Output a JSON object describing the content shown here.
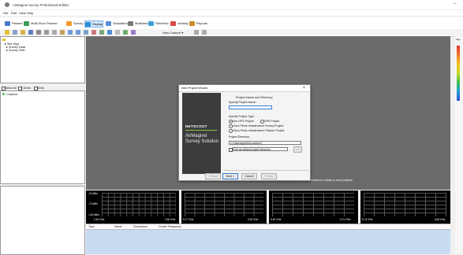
{
  "app": {
    "title": "AirMagnet Survey Professional Edition",
    "minimize": "—"
  },
  "menu": [
    "File",
    "Edit",
    "View",
    "Help"
  ],
  "ribbon": {
    "items": [
      {
        "label": "Planner",
        "color": "#4a7bd0"
      },
      {
        "label": "Multi-Floor Planner",
        "color": "#3b9c58"
      },
      {
        "label": "Survey",
        "color": "#f09a2a"
      },
      {
        "label": "Display",
        "color": "#2f8fd6"
      },
      {
        "label": "Simulation",
        "color": "#5b8fd8"
      },
      {
        "label": "Multiview",
        "color": "#7a7a7a"
      },
      {
        "label": "iSiteView",
        "color": "#3ea0d8"
      },
      {
        "label": "vorticity",
        "color": "#d84a4a"
      },
      {
        "label": "Reports",
        "color": "#cc8d2a"
      }
    ],
    "selected_index": 3
  },
  "toolbar2": {
    "view_channel_label": "View Channel ▾"
  },
  "site_tree": {
    "items": [
      "Site Map",
      "Survey Data",
      "Survey Path"
    ]
  },
  "band_filter": {
    "select_all": "Select All",
    "band_24": "2.4GHz",
    "band_5": "5GHz"
  },
  "channel_list": {
    "header": "Channel"
  },
  "dialog": {
    "title": "New Project Wizard",
    "close": "×",
    "section_heading": "Project Name and Directory",
    "name_label": "Specify Project Name:",
    "name_value": "",
    "type_label": "Specify Project Type:",
    "types": [
      {
        "label": "Non GPS Project",
        "on": true
      },
      {
        "label": "GPS Project",
        "on": false
      },
      {
        "label": "Cisco Prime Infrastructure Survey Project",
        "on": false
      },
      {
        "label": "Cisco Prime Infrastructure Planner Project",
        "on": false
      }
    ],
    "dir_label": "Project Directory:",
    "dir_value": "C:\\Users\\gpet\\Documents\\",
    "default_dir": "Set as default project directory",
    "browse": "...",
    "brand_netscout": "NETSCOUT",
    "brand_line1": "AirMagnet",
    "brand_line2": "Survey Solution",
    "buttons": {
      "back": "< Back",
      "next": "Next >",
      "cancel": "Cancel",
      "finish": "Finish"
    }
  },
  "hint": "Project Wizard to create a new project",
  "spectrum": [
    {
      "y_labels": [
        "-20 dBm",
        "-70 dBm",
        "-100 dBm"
      ],
      "x_start": "2.40 GHz",
      "x_end": "2.48 GHz"
    },
    {
      "x_start": "5.17 GHz",
      "x_end": "5.33 GHz"
    },
    {
      "x_start": "5.49 GHz",
      "x_end": "5.71 GHz"
    },
    {
      "x_start": "5.74 GHz",
      "x_end": "5.84 GHz"
    }
  ],
  "table": {
    "headers": [
      "Type",
      "Name",
      "Description",
      "Center Frequency"
    ]
  },
  "legend": {
    "label": "Sign",
    "colors": [
      "#e9302b",
      "#f27a20",
      "#f4c01c",
      "#c6d92b",
      "#3fbf4a",
      "#1f9fd8",
      "#2b4fd0"
    ]
  }
}
